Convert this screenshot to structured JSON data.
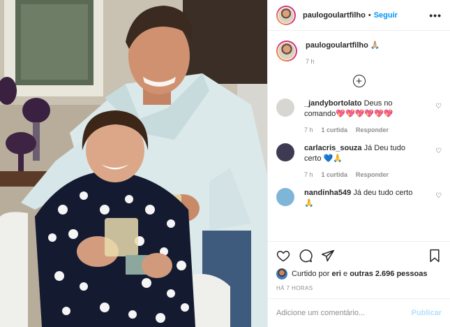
{
  "header": {
    "username": "paulogoulartfilho",
    "separator": "•",
    "follow_label": "Seguir",
    "more_icon": "more-horizontal-icon",
    "more_label": "•••"
  },
  "caption": {
    "username": "paulogoulartfilho",
    "text": "🙏🏼",
    "time": "7 h"
  },
  "load_more": {
    "icon": "plus-circle-icon",
    "label": "+"
  },
  "comments": [
    {
      "username": "_jandybortolato",
      "text": "Deus no comando💖💖💖💖💖💖",
      "time": "7 h",
      "likes": "1 curtida",
      "reply": "Responder",
      "avatar_color": "#d8d6d2"
    },
    {
      "username": "carlacris_souza",
      "text": "Já Deu tudo certo 💙🙏",
      "time": "7 h",
      "likes": "1 curtida",
      "reply": "Responder",
      "avatar_color": "#3d3a52"
    },
    {
      "username": "nandinha549",
      "text": "Já deu tudo certo 🙏",
      "avatar_color": "#7fb6d8"
    }
  ],
  "like_icon_glyph": "♡",
  "actions": {
    "like_icon": "heart-icon",
    "comment_icon": "comment-icon",
    "share_icon": "send-icon",
    "save_icon": "bookmark-icon"
  },
  "likes": {
    "prefix": "Curtido por",
    "user": "eri",
    "middle": "e",
    "others": "outras 2.696 pessoas"
  },
  "post_time": "HÁ 7 HORAS",
  "add_comment": {
    "placeholder": "Adicione um comentário...",
    "publish_label": "Publicar"
  },
  "colors": {
    "accent": "#0095f6",
    "publish_disabled": "#b2dffc",
    "muted": "#8e8e8e"
  }
}
